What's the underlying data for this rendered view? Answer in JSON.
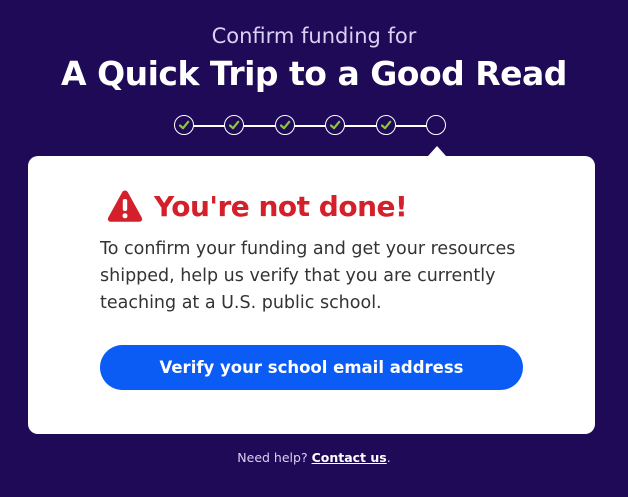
{
  "header": {
    "subtitle": "Confirm funding for",
    "title": "A Quick Trip to a Good Read"
  },
  "progress": {
    "steps_completed": 5,
    "steps_total": 6,
    "check_color": "#8cc63f"
  },
  "alert": {
    "icon": "warning-triangle-icon",
    "heading": "You're not done!",
    "message": "To confirm your funding and get your resources shipped, help us verify that you are currently teaching at a U.S. public school.",
    "color": "#d3202a"
  },
  "actions": {
    "verify_label": "Verify your school email address",
    "verify_color": "#0a5cf5"
  },
  "footer": {
    "help_prefix": "Need help?",
    "contact_label": "Contact us",
    "suffix": "."
  }
}
